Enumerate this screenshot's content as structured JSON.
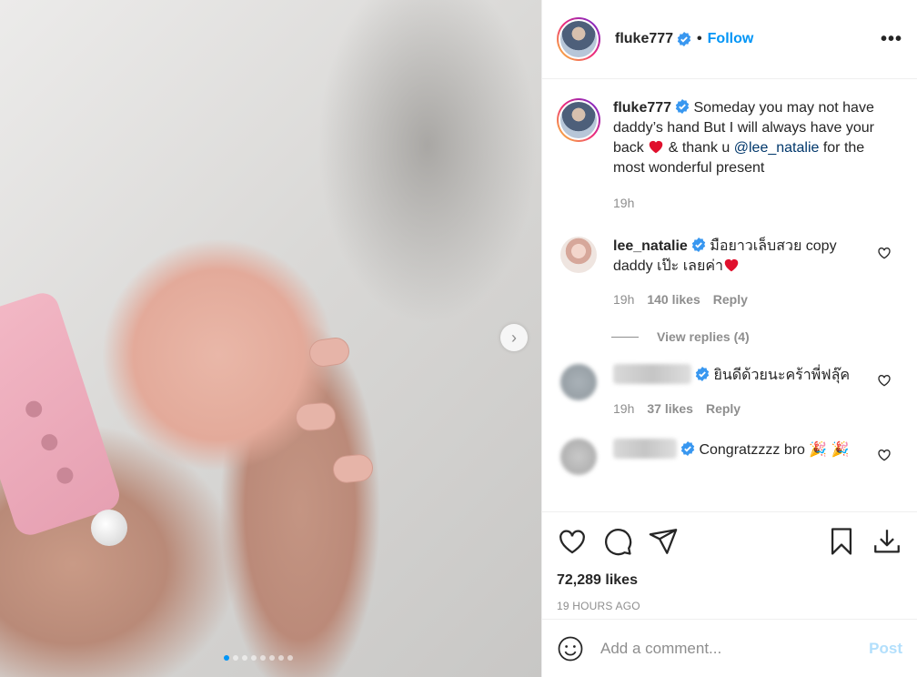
{
  "post": {
    "image_alt": "baby hand holding a finger",
    "carousel_count": 8,
    "carousel_active": 1
  },
  "header": {
    "username": "fluke777",
    "separator": "•",
    "follow_label": "Follow",
    "more_icon": "more-options-icon"
  },
  "caption": {
    "username": "fluke777",
    "text_part1": "Someday you may not have daddy’s hand But I will always have your back ",
    "text_part2": " & thank u ",
    "mention": "@lee_natalie",
    "text_part3": " for the most wonderful present",
    "time": "19h"
  },
  "comments": [
    {
      "username": "lee_natalie",
      "text": "มือยาวเล็บสวย copy daddy เป๊ะ เลยค่า",
      "time": "19h",
      "likes": "140 likes",
      "reply": "Reply",
      "view_replies": "View replies (4)"
    },
    {
      "username": "",
      "text": "ยินดีด้วยนะคร้าพี่ฟลุ๊ค",
      "time": "19h",
      "likes": "37 likes",
      "reply": "Reply"
    },
    {
      "username": "",
      "text": "Congratzzzz bro"
    }
  ],
  "actions": {
    "likes_count": "72,289 likes",
    "time_ago": "19 HOURS AGO"
  },
  "add_comment": {
    "placeholder": "Add a comment...",
    "post_label": "Post"
  },
  "colors": {
    "accent": "#0095f6",
    "heart_red": "#ed4956",
    "muted": "#8e8e8e",
    "mention": "#00376b"
  }
}
